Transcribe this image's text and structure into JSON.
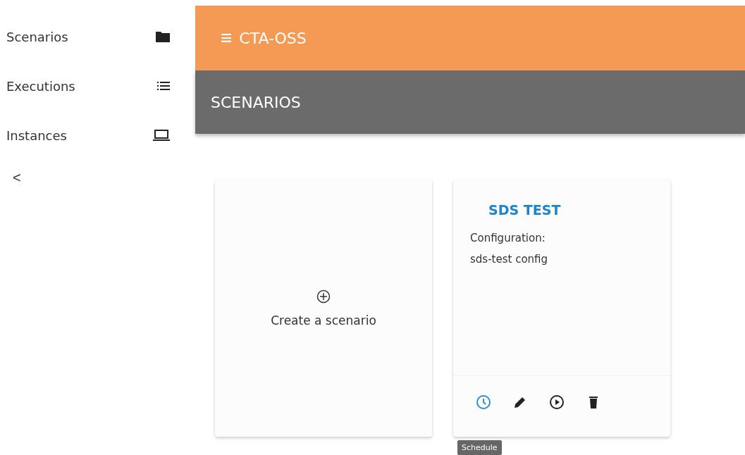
{
  "sidebar": {
    "items": [
      {
        "label": "Scenarios",
        "kind": "folder"
      },
      {
        "label": "Executions",
        "kind": "list"
      },
      {
        "label": "Instances",
        "kind": "laptop"
      }
    ],
    "collapse": "<"
  },
  "app_bar": {
    "menu": "≡",
    "title": "CTA-OSS"
  },
  "page_title": "SCENARIOS",
  "create_card": {
    "label": "Create a scenario"
  },
  "scenario_card": {
    "title": "SDS TEST",
    "lines": [
      "Configuration:",
      "sds-test config"
    ],
    "actions": [
      {
        "kind": "schedule",
        "selected": true
      },
      {
        "kind": "edit",
        "selected": false
      },
      {
        "kind": "run",
        "selected": false
      },
      {
        "kind": "delete",
        "selected": false
      }
    ],
    "tooltip": "Schedule"
  }
}
